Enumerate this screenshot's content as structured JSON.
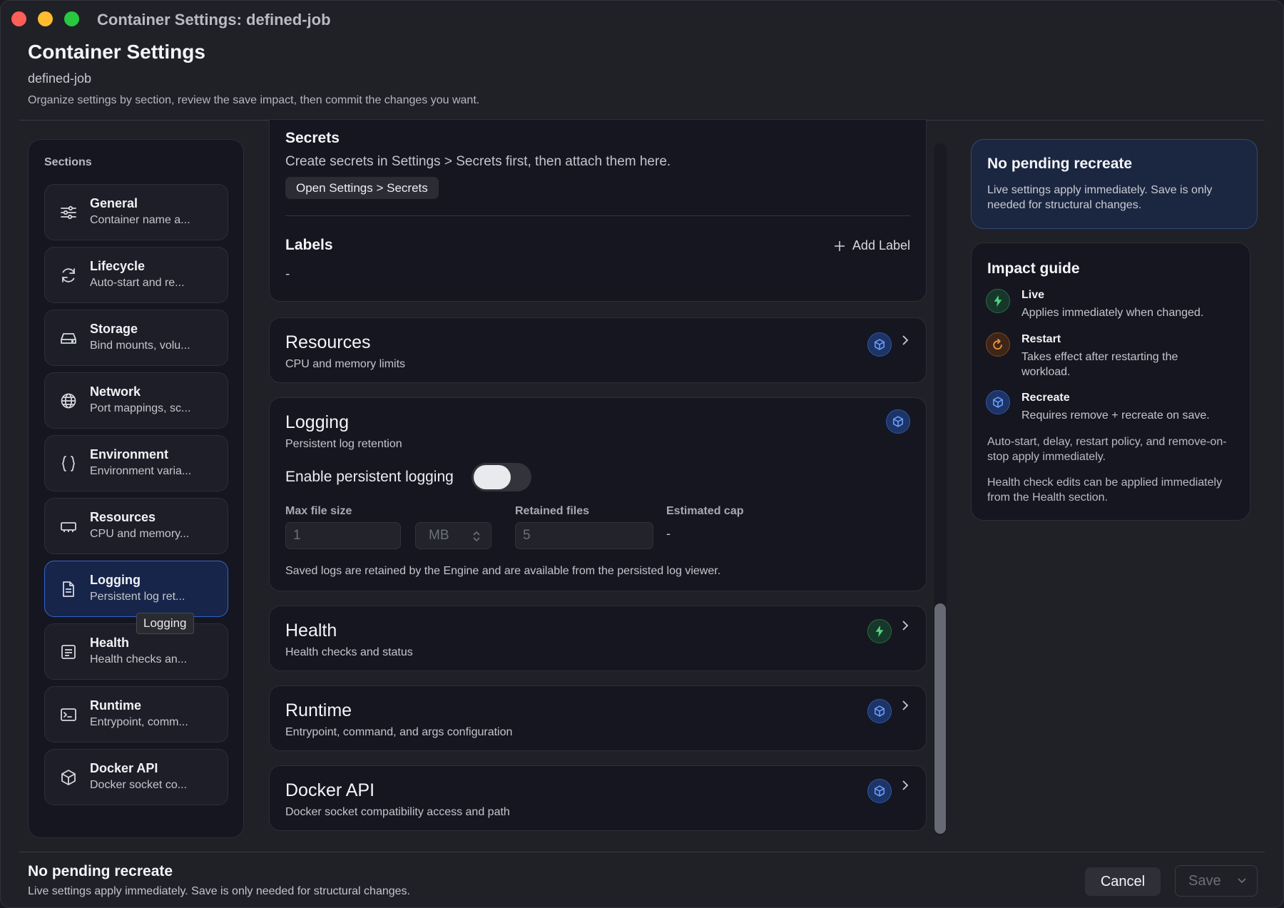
{
  "window": {
    "title": "Container Settings: defined-job"
  },
  "header": {
    "title": "Container Settings",
    "container_name": "defined-job",
    "description": "Organize settings by section, review the save impact, then commit the changes you want."
  },
  "sidebar": {
    "label": "Sections",
    "items": [
      {
        "title": "General",
        "subtitle": "Container name a...",
        "icon": "sliders-icon"
      },
      {
        "title": "Lifecycle",
        "subtitle": "Auto-start and re...",
        "icon": "refresh-icon"
      },
      {
        "title": "Storage",
        "subtitle": "Bind mounts, volu...",
        "icon": "drive-icon"
      },
      {
        "title": "Network",
        "subtitle": "Port mappings, sc...",
        "icon": "globe-icon"
      },
      {
        "title": "Environment",
        "subtitle": "Environment varia...",
        "icon": "braces-icon"
      },
      {
        "title": "Resources",
        "subtitle": "CPU and memory...",
        "icon": "memory-icon"
      },
      {
        "title": "Logging",
        "subtitle": "Persistent log ret...",
        "icon": "document-icon",
        "active": true
      },
      {
        "title": "Health",
        "subtitle": "Health checks an...",
        "icon": "health-icon"
      },
      {
        "title": "Runtime",
        "subtitle": "Entrypoint, comm...",
        "icon": "terminal-icon"
      },
      {
        "title": "Docker API",
        "subtitle": "Docker socket co...",
        "icon": "cube-icon"
      }
    ],
    "tooltip": "Logging"
  },
  "secrets": {
    "title": "Secrets",
    "description": "Create secrets in Settings > Secrets first, then attach them here.",
    "button": "Open Settings > Secrets"
  },
  "labels": {
    "title": "Labels",
    "add_button": "Add Label",
    "value": "-"
  },
  "sections": {
    "resources": {
      "title": "Resources",
      "subtitle": "CPU and memory limits",
      "impact": "recreate"
    },
    "logging": {
      "title": "Logging",
      "subtitle": "Persistent log retention",
      "impact": "recreate",
      "toggle_label": "Enable persistent logging",
      "toggle_on": false,
      "max_file_size_label": "Max file size",
      "max_file_size_value": "1",
      "unit_value": "MB",
      "retained_files_label": "Retained files",
      "retained_files_value": "5",
      "estimated_cap_label": "Estimated cap",
      "estimated_cap_value": "-",
      "note": "Saved logs are retained by the Engine and are available from the persisted log viewer."
    },
    "health": {
      "title": "Health",
      "subtitle": "Health checks and status",
      "impact": "live"
    },
    "runtime": {
      "title": "Runtime",
      "subtitle": "Entrypoint, command, and args configuration",
      "impact": "recreate"
    },
    "docker_api": {
      "title": "Docker API",
      "subtitle": "Docker socket compatibility access and path",
      "impact": "recreate"
    }
  },
  "pending": {
    "title": "No pending recreate",
    "description": "Live settings apply immediately. Save is only needed for structural changes."
  },
  "impact_guide": {
    "title": "Impact guide",
    "items": [
      {
        "name": "Live",
        "description": "Applies immediately when changed.",
        "color": "#3fb66a"
      },
      {
        "name": "Restart",
        "description": "Takes effect after restarting the workload.",
        "color": "#e8863a"
      },
      {
        "name": "Recreate",
        "description": "Requires remove + recreate on save.",
        "color": "#4c86f0"
      }
    ],
    "note1": "Auto-start, delay, restart policy, and remove-on-stop apply immediately.",
    "note2": "Health check edits can be applied immediately from the Health section."
  },
  "footer": {
    "title": "No pending recreate",
    "description": "Live settings apply immediately. Save is only needed for structural changes.",
    "cancel": "Cancel",
    "save": "Save"
  }
}
